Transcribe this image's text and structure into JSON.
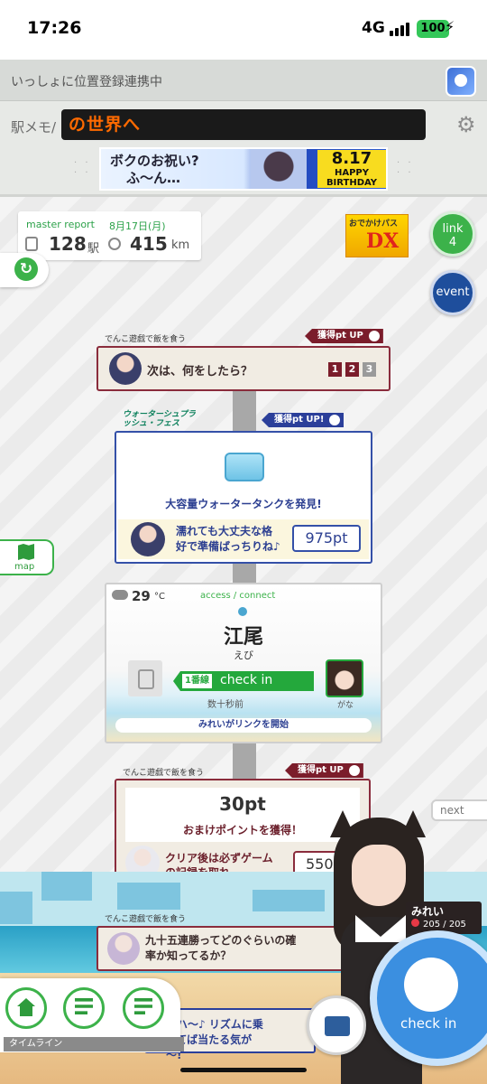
{
  "status_bar": {
    "time": "17:26",
    "network": "4G",
    "battery": "100"
  },
  "header": {
    "title": "いっしょに位置登録連携中",
    "logo": "駅メモ/",
    "marquee": "の世界へ"
  },
  "banner": {
    "left_text_1": "ボクのお祝い?",
    "left_text_2": "ふ～ん…",
    "date": "8.17",
    "line1": "HAPPY",
    "line2": "BIRTHDAY"
  },
  "report": {
    "title": "master report",
    "date": "8月17日(月)",
    "stations": "128",
    "stations_unit": "駅",
    "km": "415",
    "km_unit": "km"
  },
  "side_buttons": {
    "pass_title": "おでかけパス",
    "pass_dx": "DX",
    "link_label": "link",
    "link_count": "4",
    "event_label": "event",
    "map_label": "map",
    "next_label": "next"
  },
  "timeline": [
    {
      "tag": "でんこ遊戯で飯を食う",
      "badge": "獲得pt UP",
      "text": "次は、何をしたら？",
      "options": [
        "1",
        "2",
        "3"
      ]
    },
    {
      "fest": "ウォーターシュプラッシュ・フェス",
      "badge": "獲得pt UP!",
      "title": "大容量ウォータータンクを発見!",
      "speech_1": "濡れても大丈夫な格",
      "speech_2": "好で準備ばっちりね♪",
      "points": "975pt"
    },
    {
      "temp": "29",
      "temp_unit": "°C",
      "access": "access / connect",
      "station": "江尾",
      "kana": "えび",
      "line": "1番線",
      "checkin": "check in",
      "ago": "数十秒前",
      "partner": "がな",
      "link_start": "みれいがリンクを開始"
    },
    {
      "tag": "でんこ遊戯で飯を食う",
      "badge": "獲得pt UP",
      "points_big": "30pt",
      "desc": "おまけポイントを獲得！",
      "speech_1": "クリア後は必ずゲーム",
      "speech_2": "の記録を取れ。",
      "points": "550p"
    },
    {
      "tag": "でんこ遊戯で飯を食う",
      "speech_1": "九十五連勝ってどのぐらいの確",
      "speech_2": "率か知ってるか？"
    },
    {
      "speech_1": "ロハ～♪ リズムに乗",
      "speech_2": "ってば当たる気が",
      "speech_3": "～!"
    }
  ],
  "character": {
    "name": "みれい",
    "hp": "205 / 205"
  },
  "bottom": {
    "timeline_label": "タイムライン",
    "checkin_label": "check in"
  }
}
